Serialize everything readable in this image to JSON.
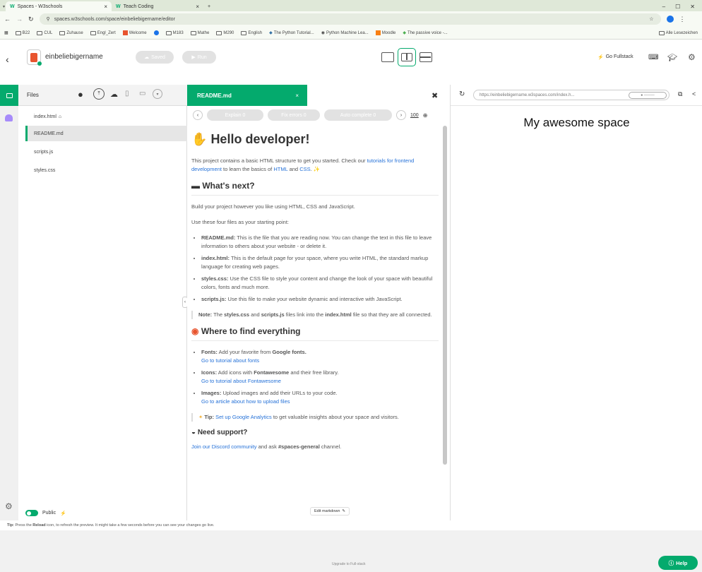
{
  "browser": {
    "tabs": [
      {
        "label": "Spaces - W3schools",
        "close": "×"
      },
      {
        "label": "Teach Coding",
        "close": "×"
      }
    ],
    "new_tab": "+",
    "url": "spaces.w3schools.com/space/einbeliebigername/editor",
    "bookmarks": [
      "B22",
      "CUL",
      "Zuhause",
      "Engl_Zert",
      "Welcome",
      "",
      "M183",
      "Mathe",
      "M290",
      "English",
      "The Python Tutorial...",
      "Python Machine Lea...",
      "Moodle",
      "The passive voice -..."
    ],
    "bookmarks_right": "Alle Lesezeichen"
  },
  "app": {
    "space_name": "einbeliebigername",
    "saved_label": "Saved",
    "run_label": "Run",
    "go_fullstack": "Go Fullstack"
  },
  "files": {
    "header": "Files",
    "items": [
      "index.html",
      "README.md",
      "scripts.js",
      "styles.css"
    ],
    "selected": 1,
    "public_label": "Public"
  },
  "editor": {
    "tab_label": "README.md",
    "explain": "Explain",
    "fix_errors": "Fix errors",
    "auto_complete": "Auto complete",
    "ai_count": "0",
    "zoom": "100",
    "edit_markdown": "Edit markdown",
    "content": {
      "h1": "Hello developer!",
      "intro_1": "This project contains a basic HTML structure to get you started. Check our",
      "intro_link": "tutorials for frontend development",
      "intro_2": "to learn the basics of",
      "html": "HTML",
      "and": "and",
      "css": "CSS",
      "h2_next": "What's next?",
      "p_build": "Build your project however you like using HTML, CSS and JavaScript.",
      "p_use": "Use these four files as your starting point:",
      "files_list": [
        {
          "name": "README.md:",
          "text": "This is the file that you are reading now. You can change the text in this file to leave information to others about your website - or delete it."
        },
        {
          "name": "index.html:",
          "text": "This is the default page for your space, where you write HTML, the standard markup language for creating web pages."
        },
        {
          "name": "styles.css:",
          "text": "Use the CSS file to style your content and change the look of your space with beautiful colors, fonts and much more."
        },
        {
          "name": "scripts.js:",
          "text": "Use this file to make your website dynamic and interactive with JavaScript."
        }
      ],
      "note_label": "Note:",
      "note_1": "The",
      "note_styles": "styles.css",
      "note_and": "and",
      "note_scripts": "scripts.js",
      "note_2": "files link into the",
      "note_index": "index.html",
      "note_3": "file so that they are all connected.",
      "h2_where": "Where to find everything",
      "where_list": [
        {
          "name": "Fonts:",
          "text": "Add your favorite from",
          "bold": "Google fonts.",
          "link": "Go to tutorial about fonts"
        },
        {
          "name": "Icons:",
          "text": "Add icons with",
          "bold": "Fontawesome",
          "text2": "and their free library.",
          "link": "Go to tutorial about Fontawesome"
        },
        {
          "name": "Images:",
          "text": "Upload images and add their URLs to your code.",
          "link": "Go to article about how to upload files"
        }
      ],
      "tip_label": "Tip:",
      "tip_link": "Set up Google Analytics",
      "tip_text": "to get valuable insights about your space and visitors.",
      "h3_support": "Need support?",
      "support_link": "Join our Discord community",
      "support_text": "and ask",
      "support_channel": "#spaces-general",
      "support_end": "channel."
    }
  },
  "preview": {
    "url": "https://einbeliebigername.w3spaces.com/index.h...",
    "heading": "My awesome space"
  },
  "bottom": {
    "tip_label": "Tip:",
    "tip_text_1": "Press the",
    "tip_reload": "Reload",
    "tip_text_2": "icon, to refresh the preview. It might take a few seconds before you can see your changes go live.",
    "footer_text": "Upgrade to Full-stack",
    "help_label": "Help"
  },
  "colors": {
    "accent": "#04aa6d",
    "link": "#2672d8",
    "browser_chrome": "#dfe8d8"
  }
}
